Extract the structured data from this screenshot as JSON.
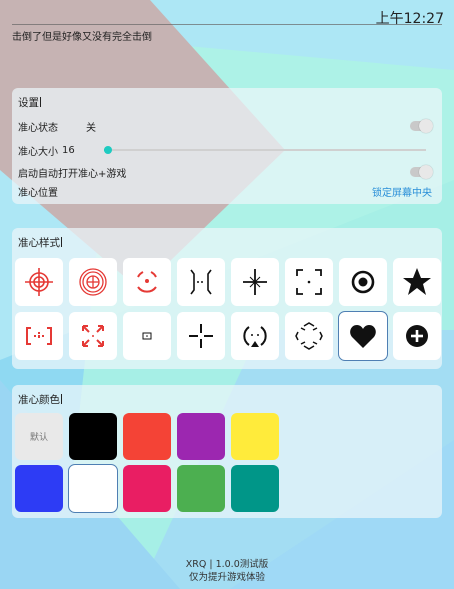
{
  "status_bar": {
    "time": "上午12:27"
  },
  "header": {
    "subtitle": "击倒了但是好像又没有完全击倒"
  },
  "settings": {
    "title": "设置",
    "crosshair_status": {
      "label": "准心状态",
      "value": "关",
      "on": false
    },
    "crosshair_size": {
      "label": "准心大小",
      "value": "16"
    },
    "auto_start": {
      "label": "启动自动打开准心+游戏",
      "on": false
    },
    "crosshair_position": {
      "label": "准心位置",
      "action": "锁定屏幕中央"
    }
  },
  "styles": {
    "title": "准心样式",
    "items": [
      "red-scope-crosshair-icon",
      "red-target-circle-icon",
      "red-circle-brackets-icon",
      "bracket-lines-icon",
      "ornate-plus-crosshair-icon",
      "corner-brackets-dot-icon",
      "bullseye-dot-icon",
      "star-icon",
      "red-dashed-brackets-icon",
      "red-arrow-x-crosshair-icon",
      "small-square-dot-icon",
      "plus-crosshair-icon",
      "circle-arrows-icon",
      "chevron-ring-icon",
      "heart-icon",
      "plus-circle-icon"
    ],
    "selected_index": 14
  },
  "colors": {
    "title": "准心颜色",
    "default_label": "默认",
    "swatches": [
      "#e9e9e9",
      "#000000",
      "#f44336",
      "#9c27b0",
      "#ffeb3b",
      "#2d3cf5",
      "#ffffff",
      "#e91e63",
      "#4caf50",
      "#009688"
    ],
    "selected_index": 6
  },
  "footer": {
    "version": "XRQ | 1.0.0测试版",
    "note": "仅为提升游戏体验"
  }
}
